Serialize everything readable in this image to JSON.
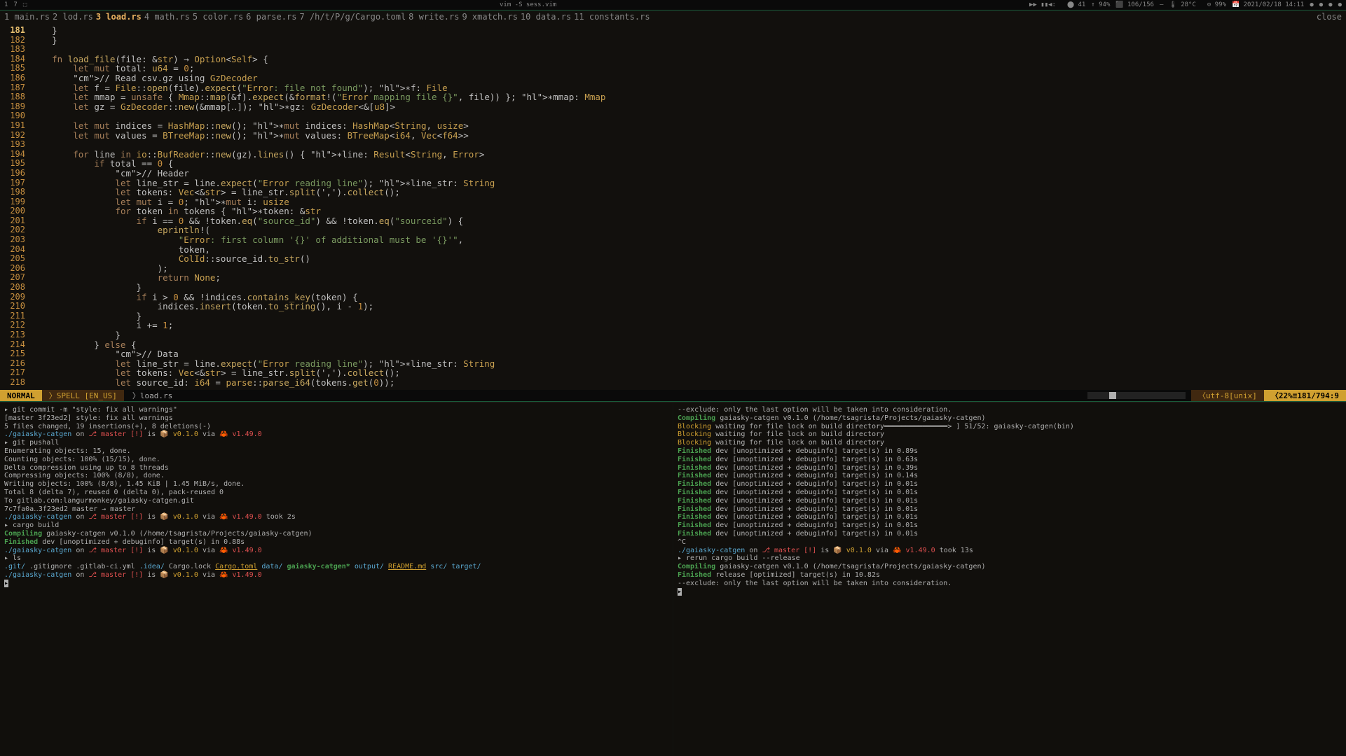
{
  "topbar": {
    "left": [
      "1",
      "7",
      "⬚"
    ],
    "title": "vim -S sess.vim",
    "right": [
      "▶▶ ▮▮◀:",
      "",
      "⬤ 41",
      "↑ 94%",
      "⬛ 106/156",
      "—",
      "🌡 28°C",
      "",
      "⊙ 99%",
      "📅 2021/02/18 14:11"
    ]
  },
  "tabs": [
    {
      "n": "1",
      "t": "main.rs"
    },
    {
      "n": "2",
      "t": "lod.rs"
    },
    {
      "n": "3",
      "t": "load.rs",
      "active": true
    },
    {
      "n": "4",
      "t": "math.rs"
    },
    {
      "n": "5",
      "t": "color.rs"
    },
    {
      "n": "6",
      "t": "parse.rs"
    },
    {
      "n": "7",
      "t": "/h/t/P/g/Cargo.toml"
    },
    {
      "n": "8",
      "t": "write.rs"
    },
    {
      "n": "9",
      "t": "xmatch.rs"
    },
    {
      "n": "10",
      "t": "data.rs"
    },
    {
      "n": "11",
      "t": "constants.rs"
    }
  ],
  "close": "close",
  "lines": {
    "first": 181,
    "last": 218,
    "cursor": 181
  },
  "code": [
    "    }",
    "    }",
    "",
    "    fn load_file(file: &str) → Option<Self> {",
    "        let mut total: u64 = 0;",
    "        // Read csv.gz using GzDecoder",
    "        let f = File::open(file).expect(\"Error: file not found\"); ∗f: File",
    "        let mmap = unsafe { Mmap::map(&f).expect(&format!(\"Error mapping file {}\", file)) }; ∗mmap: Mmap",
    "        let gz = GzDecoder::new(&mmap[‥]); ∗gz: GzDecoder<&[u8]>",
    "",
    "        let mut indices = HashMap::new(); ∗mut indices: HashMap<String, usize>",
    "        let mut values = BTreeMap::new(); ∗mut values: BTreeMap<i64, Vec<f64>>",
    "",
    "        for line in io::BufReader::new(gz).lines() { ∗line: Result<String, Error>",
    "            if total == 0 {",
    "                // Header",
    "                let line_str = line.expect(\"Error reading line\"); ∗line_str: String",
    "                let tokens: Vec<&str> = line_str.split(',').collect();",
    "                let mut i = 0; ∗mut i: usize",
    "                for token in tokens { ∗token: &str",
    "                    if i == 0 && !token.eq(\"source_id\") && !token.eq(\"sourceid\") {",
    "                        eprintln!(",
    "                            \"Error: first column '{}' of additional must be '{}'\",",
    "                            token,",
    "                            ColId::source_id.to_str()",
    "                        );",
    "                        return None;",
    "                    }",
    "                    if i > 0 && !indices.contains_key(token) {",
    "                        indices.insert(token.to_string(), i - 1);",
    "                    }",
    "                    i += 1;",
    "                }",
    "            } else {",
    "                // Data",
    "                let line_str = line.expect(\"Error reading line\"); ∗line_str: String",
    "                let tokens: Vec<&str> = line_str.split(',').collect();",
    "                let source_id: i64 = parse::parse_i64(tokens.get(0));"
  ],
  "statusbar": {
    "mode": "NORMAL",
    "spell": "SPELL [EN_US]",
    "file": "load.rs",
    "enc": "utf-8[unix]",
    "pct": "22%",
    "pos": "181/794",
    "col": ":9"
  },
  "term_prompt": {
    "path": "./gaiasky-catgen",
    "on": "on",
    "branch": "master",
    "flag": "[!]",
    "is": "is",
    "pkg": "📦 v0.1.0",
    "via": "via",
    "rust": "🦀 v1.49.0"
  },
  "term_left": [
    {
      "c": "wh",
      "t": "▸ git commit -m \"style: fix all warnings\""
    },
    {
      "c": "wh",
      "t": "[master 3f23ed2] style: fix all warnings"
    },
    {
      "c": "wh",
      "t": " 5 files changed, 19 insertions(+), 8 deletions(-)"
    },
    {
      "c": "prompt"
    },
    {
      "c": "wh",
      "t": "▸ git pushall"
    },
    {
      "c": "wh",
      "t": "Enumerating objects: 15, done."
    },
    {
      "c": "wh",
      "t": "Counting objects: 100% (15/15), done."
    },
    {
      "c": "wh",
      "t": "Delta compression using up to 8 threads"
    },
    {
      "c": "wh",
      "t": "Compressing objects: 100% (8/8), done."
    },
    {
      "c": "wh",
      "t": "Writing objects: 100% (8/8), 1.45 KiB | 1.45 MiB/s, done."
    },
    {
      "c": "wh",
      "t": "Total 8 (delta 7), reused 0 (delta 0), pack-reused 0"
    },
    {
      "c": "wh",
      "t": "To gitlab.com:langurmonkey/gaiasky-catgen.git"
    },
    {
      "c": "wh",
      "t": "   7c7fa0a‥3f23ed2  master → master"
    },
    {
      "c": "prompt",
      "extra": "took 2s"
    },
    {
      "c": "wh",
      "t": "▸ cargo build"
    },
    {
      "c": "compile",
      "t": "   Compiling gaiasky-catgen v0.1.0 (/home/tsagrista/Projects/gaiasky-catgen)"
    },
    {
      "c": "finish",
      "t": "    Finished dev [unoptimized + debuginfo] target(s) in 0.88s"
    },
    {
      "c": "prompt"
    },
    {
      "c": "wh",
      "t": "▸ ls"
    },
    {
      "c": "ls"
    },
    {
      "c": "prompt"
    },
    {
      "c": "cursor"
    }
  ],
  "ls_items": [
    {
      "t": ".git/",
      "c": "blu"
    },
    {
      "t": ".gitignore",
      "c": "wh"
    },
    {
      "t": ".gitlab-ci.yml",
      "c": "wh"
    },
    {
      "t": ".idea/",
      "c": "blu"
    },
    {
      "t": "Cargo.lock",
      "c": "wh"
    },
    {
      "t": "Cargo.toml",
      "c": "yel",
      "u": true
    },
    {
      "t": "data/",
      "c": "blu"
    },
    {
      "t": "gaiasky-catgen*",
      "c": "grn"
    },
    {
      "t": "output/",
      "c": "blu"
    },
    {
      "t": "README.md",
      "c": "yel",
      "u": true
    },
    {
      "t": "src/",
      "c": "blu"
    },
    {
      "t": "target/",
      "c": "blu"
    }
  ],
  "term_right": [
    {
      "c": "wh",
      "t": "--exclude: only the last option will be taken into consideration."
    },
    {
      "c": "compile",
      "t": "   Compiling gaiasky-catgen v0.1.0 (/home/tsagrista/Projects/gaiasky-catgen)"
    },
    {
      "c": "block",
      "t": "    Blocking waiting for file lock on build directory═══════════════> ] 51/52: gaiasky-catgen(bin)"
    },
    {
      "c": "block",
      "t": "    Blocking waiting for file lock on build directory"
    },
    {
      "c": "block",
      "t": "    Blocking waiting for file lock on build directory"
    },
    {
      "c": "finish",
      "t": "    Finished dev [unoptimized + debuginfo] target(s) in 0.89s"
    },
    {
      "c": "finish",
      "t": "    Finished dev [unoptimized + debuginfo] target(s) in 0.63s"
    },
    {
      "c": "finish",
      "t": "    Finished dev [unoptimized + debuginfo] target(s) in 0.39s"
    },
    {
      "c": "finish",
      "t": "    Finished dev [unoptimized + debuginfo] target(s) in 0.14s"
    },
    {
      "c": "finish",
      "t": "    Finished dev [unoptimized + debuginfo] target(s) in 0.01s"
    },
    {
      "c": "finish",
      "t": "    Finished dev [unoptimized + debuginfo] target(s) in 0.01s"
    },
    {
      "c": "finish",
      "t": "    Finished dev [unoptimized + debuginfo] target(s) in 0.01s"
    },
    {
      "c": "finish",
      "t": "    Finished dev [unoptimized + debuginfo] target(s) in 0.01s"
    },
    {
      "c": "finish",
      "t": "    Finished dev [unoptimized + debuginfo] target(s) in 0.01s"
    },
    {
      "c": "finish",
      "t": "    Finished dev [unoptimized + debuginfo] target(s) in 0.01s"
    },
    {
      "c": "finish",
      "t": "    Finished dev [unoptimized + debuginfo] target(s) in 0.01s"
    },
    {
      "c": "wh",
      "t": "^C"
    },
    {
      "c": "prompt",
      "extra": "took 13s"
    },
    {
      "c": "wh",
      "t": "▸ rerun cargo build --release"
    },
    {
      "c": "compile",
      "t": "   Compiling gaiasky-catgen v0.1.0 (/home/tsagrista/Projects/gaiasky-catgen)"
    },
    {
      "c": "finish",
      "t": "    Finished release [optimized] target(s) in 10.82s"
    },
    {
      "c": "wh",
      "t": "--exclude: only the last option will be taken into consideration."
    },
    {
      "c": "cursor"
    }
  ]
}
